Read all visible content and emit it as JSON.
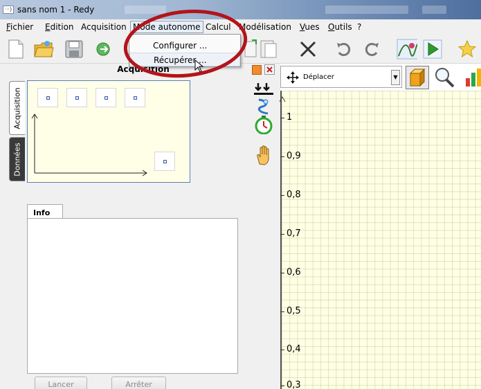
{
  "window": {
    "title": "sans nom 1 - Redy"
  },
  "menubar": {
    "items": [
      {
        "label": "Fichier",
        "accel": "F"
      },
      {
        "label": "Edition",
        "accel": "E"
      },
      {
        "label": "Acquisition",
        "accel": ""
      },
      {
        "label": "Mode autonome",
        "accel": ""
      },
      {
        "label": "Calcul",
        "accel": ""
      },
      {
        "label": "Modélisation",
        "accel": ""
      },
      {
        "label": "Vues",
        "accel": "V"
      },
      {
        "label": "Outils",
        "accel": "O"
      },
      {
        "label": "?",
        "accel": ""
      }
    ],
    "active": "Mode autonome"
  },
  "dropdown": {
    "items": [
      {
        "label": "Configurer ..."
      },
      {
        "label": "Récupérer ..."
      }
    ]
  },
  "left_tabs": {
    "acquisition": "Acquisition",
    "donnees": "Données"
  },
  "acquisition_panel": {
    "title": "Acquisition"
  },
  "info_panel": {
    "tab_label": "Info",
    "lancer": "Lancer",
    "arreter": "Arrêter"
  },
  "plot_toolbar": {
    "mode": "Déplacer"
  },
  "y_axis": {
    "ticks": [
      "1",
      "0,9",
      "0,8",
      "0,7",
      "0,6",
      "0,5",
      "0,4",
      "0,3"
    ]
  },
  "colors": {
    "highlight": "#b3141b",
    "plot_bg": "#ffffe4",
    "preview_border": "#5a7fb7"
  }
}
